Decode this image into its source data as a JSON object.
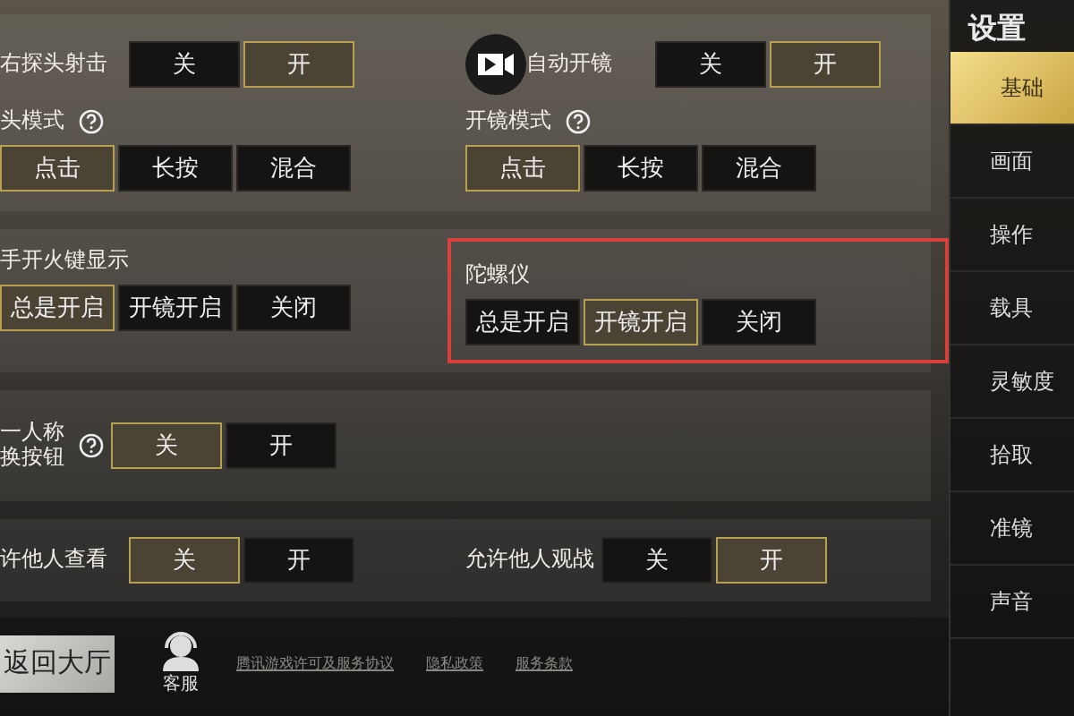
{
  "panels": [
    {
      "groups": [
        {
          "kind": "inline",
          "label": "右探头射击",
          "options": [
            {
              "label": "关",
              "selected": false
            },
            {
              "label": "开",
              "selected": true
            }
          ]
        },
        {
          "kind": "inline",
          "label": "自动开镜",
          "options": [
            {
              "label": "关",
              "selected": false
            },
            {
              "label": "开",
              "selected": true
            }
          ]
        },
        {
          "kind": "stacked",
          "label": "头模式",
          "help": true,
          "options": [
            {
              "label": "点击",
              "selected": true
            },
            {
              "label": "长按",
              "selected": false
            },
            {
              "label": "混合",
              "selected": false
            }
          ]
        },
        {
          "kind": "stacked",
          "label": "开镜模式",
          "help": true,
          "options": [
            {
              "label": "点击",
              "selected": true
            },
            {
              "label": "长按",
              "selected": false
            },
            {
              "label": "混合",
              "selected": false
            }
          ]
        }
      ]
    },
    {
      "groups": [
        {
          "kind": "stacked",
          "label": "手开火键显示",
          "options": [
            {
              "label": "总是开启",
              "selected": true
            },
            {
              "label": "开镜开启",
              "selected": false
            },
            {
              "label": "关闭",
              "selected": false
            }
          ]
        },
        {
          "kind": "stacked",
          "label": "陀螺仪",
          "highlighted": true,
          "options": [
            {
              "label": "总是开启",
              "selected": false
            },
            {
              "label": "开镜开启",
              "selected": true
            },
            {
              "label": "关闭",
              "selected": false
            }
          ]
        }
      ]
    },
    {
      "groups": [
        {
          "kind": "inline",
          "label_lines": [
            "一人称",
            "换按钮"
          ],
          "help": true,
          "options": [
            {
              "label": "关",
              "selected": true
            },
            {
              "label": "开",
              "selected": false
            }
          ]
        }
      ]
    },
    {
      "groups": [
        {
          "kind": "inline",
          "label": "许他人查看",
          "options": [
            {
              "label": "关",
              "selected": true
            },
            {
              "label": "开",
              "selected": false
            }
          ]
        },
        {
          "kind": "inline",
          "label": "允许他人观战",
          "options": [
            {
              "label": "关",
              "selected": false
            },
            {
              "label": "开",
              "selected": true
            }
          ]
        }
      ]
    }
  ],
  "footer": {
    "back_button": "返回大厅",
    "service": "客服",
    "links": [
      "腾讯游戏许可及服务协议",
      "隐私政策",
      "服务条款"
    ]
  },
  "sidebar": {
    "title": "设置",
    "items": [
      {
        "label": "基础",
        "selected": true
      },
      {
        "label": "画面",
        "selected": false
      },
      {
        "label": "操作",
        "selected": false
      },
      {
        "label": "载具",
        "selected": false
      },
      {
        "label": "灵敏度",
        "selected": false
      },
      {
        "label": "拾取",
        "selected": false
      },
      {
        "label": "准镜",
        "selected": false
      },
      {
        "label": "声音",
        "selected": false
      }
    ]
  }
}
